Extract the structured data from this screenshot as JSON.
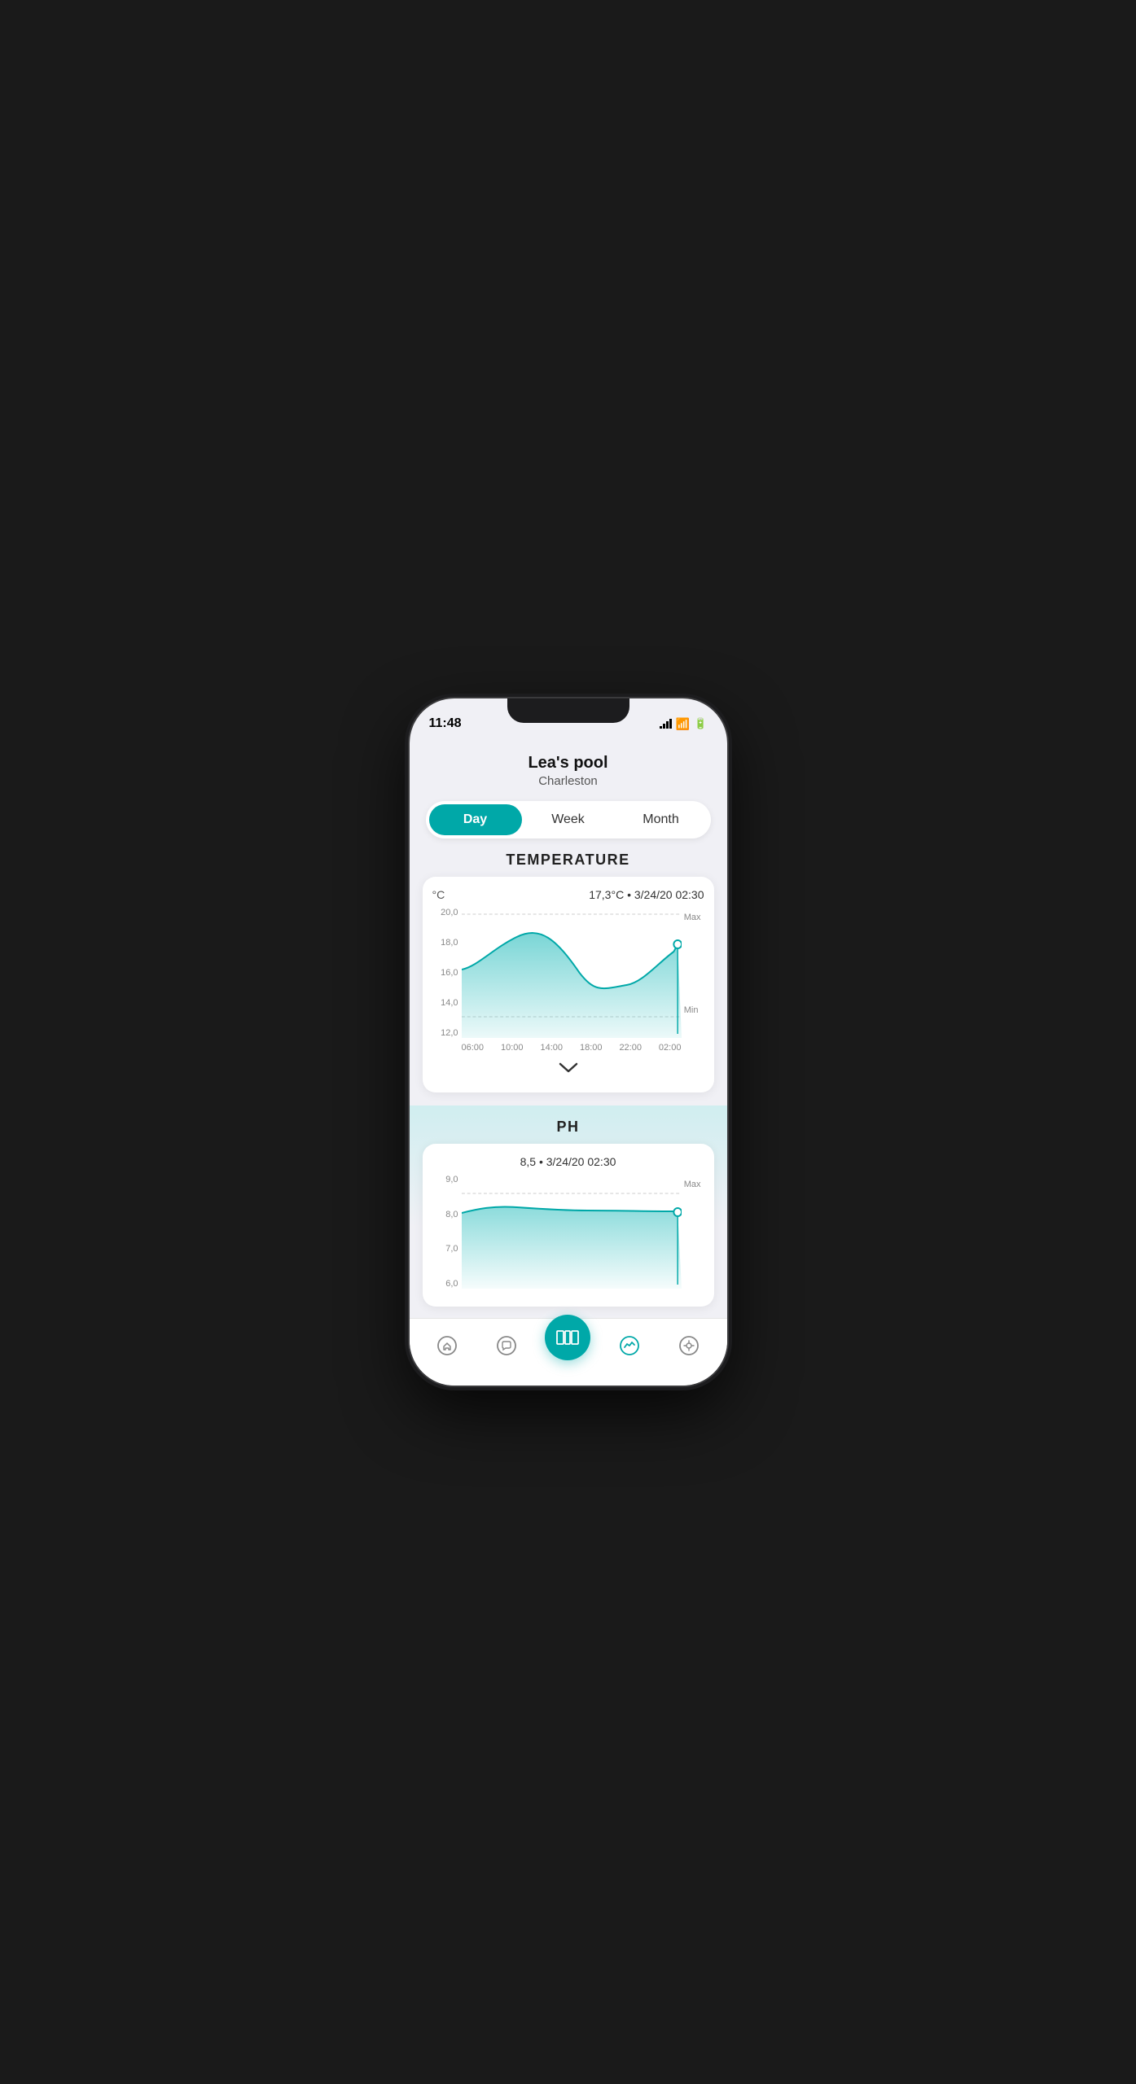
{
  "status": {
    "time": "11:48",
    "signal_bars": [
      3,
      6,
      9,
      12
    ],
    "wifi": "wifi",
    "battery": "battery"
  },
  "header": {
    "pool_name": "Lea's pool",
    "location": "Charleston"
  },
  "tabs": {
    "items": [
      {
        "label": "Day",
        "active": true
      },
      {
        "label": "Week",
        "active": false
      },
      {
        "label": "Month",
        "active": false
      }
    ]
  },
  "temperature_section": {
    "title": "TEMPERATURE",
    "unit": "°C",
    "current_value": "17,3°C • 3/24/20 02:30",
    "y_labels": [
      "20,0",
      "18,0",
      "16,0",
      "14,0",
      "12,0"
    ],
    "x_labels": [
      "06:00",
      "10:00",
      "14:00",
      "18:00",
      "22:00",
      "02:00"
    ],
    "max_label": "Max",
    "min_label": "Min",
    "chevron": "⌄"
  },
  "ph_section": {
    "title": "PH",
    "current_value": "8,5 • 3/24/20 02:30",
    "y_labels": [
      "9,0",
      "8,0",
      "7,0",
      "6,0"
    ],
    "max_label": "Max"
  },
  "nav": {
    "items": [
      {
        "id": "home",
        "icon": "home"
      },
      {
        "id": "chat",
        "icon": "chat"
      },
      {
        "id": "center",
        "icon": "pool"
      },
      {
        "id": "stats",
        "icon": "stats"
      },
      {
        "id": "remote",
        "icon": "remote"
      }
    ]
  }
}
